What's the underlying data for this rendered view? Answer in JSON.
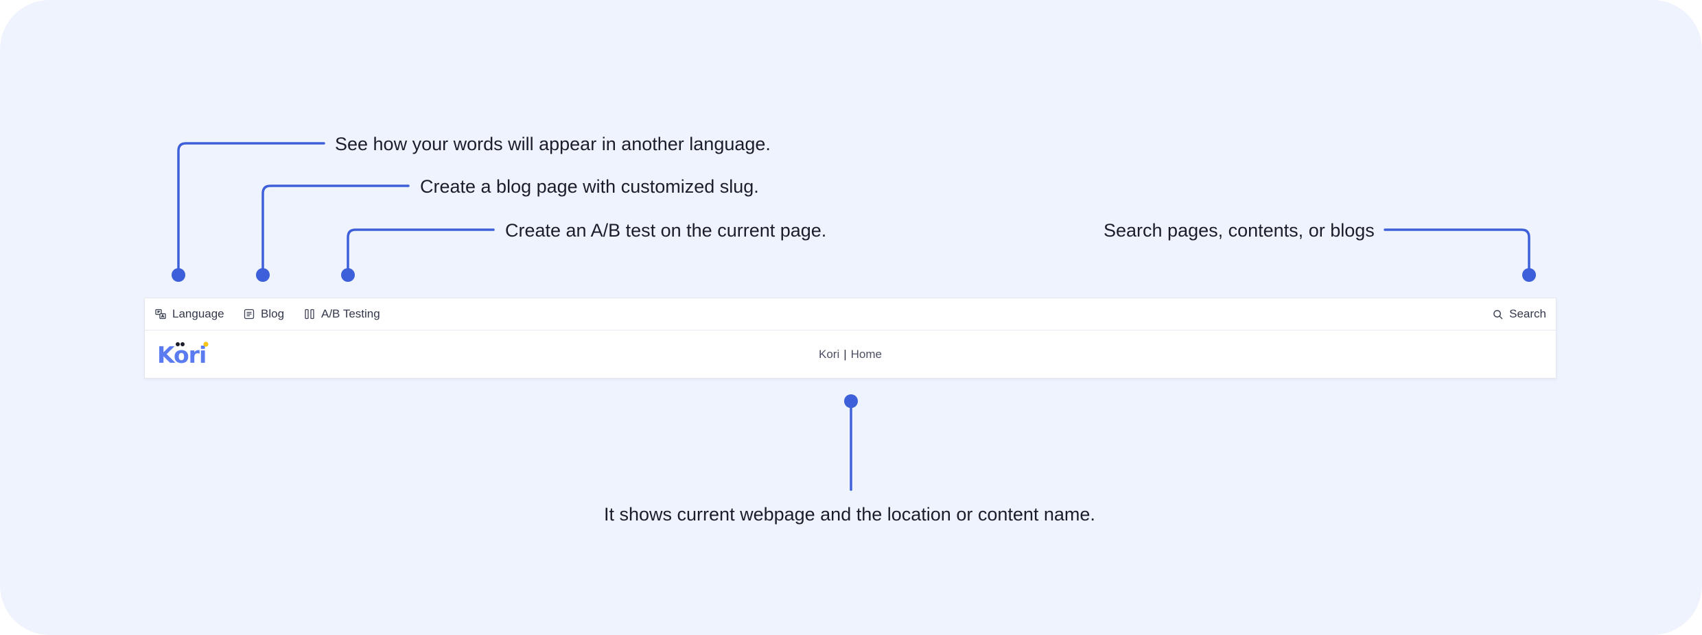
{
  "callouts": {
    "language": "See how your words will appear in another language.",
    "blog": "Create a blog page with customized slug.",
    "ab_testing": "Create an A/B test on the current page.",
    "search": "Search pages, contents, or blogs",
    "header": "It shows current webpage and the location or content name."
  },
  "toolbar": {
    "language_label": "Language",
    "blog_label": "Blog",
    "ab_testing_label": "A/B Testing",
    "search_label": "Search"
  },
  "header": {
    "logo_text": "Kori",
    "site_name": "Kori",
    "separator": "|",
    "page_name": "Home"
  },
  "colors": {
    "accent": "#3d5fd9",
    "background": "#eff3fe",
    "text": "#1b1d2b",
    "logo_blue": "#5b7cf0",
    "logo_yellow": "#f5c518"
  },
  "icons": [
    "language-icon",
    "blog-icon",
    "ab-testing-icon",
    "search-icon"
  ]
}
